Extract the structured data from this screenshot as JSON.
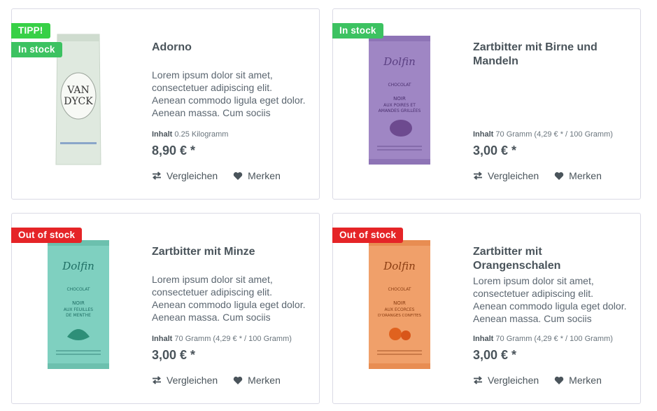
{
  "products": [
    {
      "badges": [
        "TIPP!",
        "In stock"
      ],
      "title": "Adorno",
      "description": "Lorem ipsum dolor sit amet, consectetuer adipiscing elit. Aenean commodo ligula eget dolor. Aenean massa. Cum sociis",
      "content_label": "Inhalt",
      "content_value": "0.25 Kilogramm",
      "price": "8,90 € *",
      "compare_label": "Vergleichen",
      "wishlist_label": "Merken",
      "image_text": [
        "VAN",
        "DYCK"
      ]
    },
    {
      "badges": [
        "In stock"
      ],
      "title": "Zartbitter mit Birne und Mandeln",
      "description": "",
      "content_label": "Inhalt",
      "content_value": "70 Gramm (4,29 € * / 100 Gramm)",
      "price": "3,00 € *",
      "compare_label": "Vergleichen",
      "wishlist_label": "Merken",
      "image_text": [
        "Dolfin",
        "CHOCOLAT",
        "NOIR",
        "AUX POIRES ET",
        "AMANDES GRILLÉES"
      ]
    },
    {
      "badges": [
        "Out of stock"
      ],
      "title": "Zartbitter mit Minze",
      "description": "Lorem ipsum dolor sit amet, consectetuer adipiscing elit. Aenean commodo ligula eget dolor. Aenean massa. Cum sociis",
      "content_label": "Inhalt",
      "content_value": "70 Gramm (4,29 € * / 100 Gramm)",
      "price": "3,00 € *",
      "compare_label": "Vergleichen",
      "wishlist_label": "Merken",
      "image_text": [
        "Dolfin",
        "CHOCOLAT",
        "NOIR",
        "AUX FEUILLES",
        "DE MENTHE"
      ]
    },
    {
      "badges": [
        "Out of stock"
      ],
      "title": "Zartbitter mit Orangenschalen",
      "description": "Lorem ipsum dolor sit amet, consectetuer adipiscing elit. Aenean commodo ligula eget dolor. Aenean massa. Cum sociis",
      "content_label": "Inhalt",
      "content_value": "70 Gramm (4,29 € * / 100 Gramm)",
      "price": "3,00 € *",
      "compare_label": "Vergleichen",
      "wishlist_label": "Merken",
      "image_text": [
        "Dolfin",
        "CHOCOLAT",
        "NOIR",
        "AUX ECORCES",
        "D'ORANGES CONFITES"
      ]
    }
  ],
  "colors": {
    "in_stock": "#3cc261",
    "tipp": "#37d046",
    "out_of_stock": "#e52427",
    "text": "#4a545b",
    "border": "#dadae5"
  }
}
